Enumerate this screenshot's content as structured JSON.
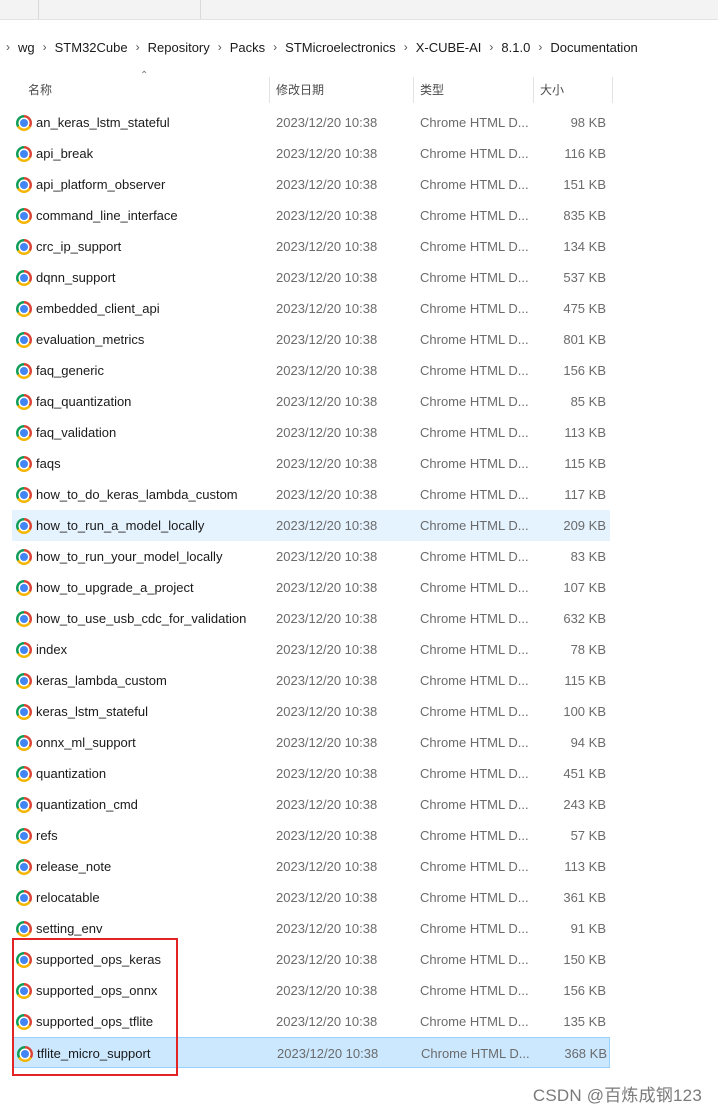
{
  "breadcrumb": [
    "wg",
    "STM32Cube",
    "Repository",
    "Packs",
    "STMicroelectronics",
    "X-CUBE-AI",
    "8.1.0",
    "Documentation"
  ],
  "columns": {
    "name": "名称",
    "date": "修改日期",
    "type": "类型",
    "size": "大小"
  },
  "files": [
    {
      "name": "an_keras_lstm_stateful",
      "date": "2023/12/20 10:38",
      "type": "Chrome HTML D...",
      "size": "98 KB"
    },
    {
      "name": "api_break",
      "date": "2023/12/20 10:38",
      "type": "Chrome HTML D...",
      "size": "116 KB"
    },
    {
      "name": "api_platform_observer",
      "date": "2023/12/20 10:38",
      "type": "Chrome HTML D...",
      "size": "151 KB"
    },
    {
      "name": "command_line_interface",
      "date": "2023/12/20 10:38",
      "type": "Chrome HTML D...",
      "size": "835 KB"
    },
    {
      "name": "crc_ip_support",
      "date": "2023/12/20 10:38",
      "type": "Chrome HTML D...",
      "size": "134 KB"
    },
    {
      "name": "dqnn_support",
      "date": "2023/12/20 10:38",
      "type": "Chrome HTML D...",
      "size": "537 KB"
    },
    {
      "name": "embedded_client_api",
      "date": "2023/12/20 10:38",
      "type": "Chrome HTML D...",
      "size": "475 KB"
    },
    {
      "name": "evaluation_metrics",
      "date": "2023/12/20 10:38",
      "type": "Chrome HTML D...",
      "size": "801 KB"
    },
    {
      "name": "faq_generic",
      "date": "2023/12/20 10:38",
      "type": "Chrome HTML D...",
      "size": "156 KB"
    },
    {
      "name": "faq_quantization",
      "date": "2023/12/20 10:38",
      "type": "Chrome HTML D...",
      "size": "85 KB"
    },
    {
      "name": "faq_validation",
      "date": "2023/12/20 10:38",
      "type": "Chrome HTML D...",
      "size": "113 KB"
    },
    {
      "name": "faqs",
      "date": "2023/12/20 10:38",
      "type": "Chrome HTML D...",
      "size": "115 KB"
    },
    {
      "name": "how_to_do_keras_lambda_custom",
      "date": "2023/12/20 10:38",
      "type": "Chrome HTML D...",
      "size": "117 KB"
    },
    {
      "name": "how_to_run_a_model_locally",
      "date": "2023/12/20 10:38",
      "type": "Chrome HTML D...",
      "size": "209 KB"
    },
    {
      "name": "how_to_run_your_model_locally",
      "date": "2023/12/20 10:38",
      "type": "Chrome HTML D...",
      "size": "83 KB"
    },
    {
      "name": "how_to_upgrade_a_project",
      "date": "2023/12/20 10:38",
      "type": "Chrome HTML D...",
      "size": "107 KB"
    },
    {
      "name": "how_to_use_usb_cdc_for_validation",
      "date": "2023/12/20 10:38",
      "type": "Chrome HTML D...",
      "size": "632 KB"
    },
    {
      "name": "index",
      "date": "2023/12/20 10:38",
      "type": "Chrome HTML D...",
      "size": "78 KB"
    },
    {
      "name": "keras_lambda_custom",
      "date": "2023/12/20 10:38",
      "type": "Chrome HTML D...",
      "size": "115 KB"
    },
    {
      "name": "keras_lstm_stateful",
      "date": "2023/12/20 10:38",
      "type": "Chrome HTML D...",
      "size": "100 KB"
    },
    {
      "name": "onnx_ml_support",
      "date": "2023/12/20 10:38",
      "type": "Chrome HTML D...",
      "size": "94 KB"
    },
    {
      "name": "quantization",
      "date": "2023/12/20 10:38",
      "type": "Chrome HTML D...",
      "size": "451 KB"
    },
    {
      "name": "quantization_cmd",
      "date": "2023/12/20 10:38",
      "type": "Chrome HTML D...",
      "size": "243 KB"
    },
    {
      "name": "refs",
      "date": "2023/12/20 10:38",
      "type": "Chrome HTML D...",
      "size": "57 KB"
    },
    {
      "name": "release_note",
      "date": "2023/12/20 10:38",
      "type": "Chrome HTML D...",
      "size": "113 KB"
    },
    {
      "name": "relocatable",
      "date": "2023/12/20 10:38",
      "type": "Chrome HTML D...",
      "size": "361 KB"
    },
    {
      "name": "setting_env",
      "date": "2023/12/20 10:38",
      "type": "Chrome HTML D...",
      "size": "91 KB"
    },
    {
      "name": "supported_ops_keras",
      "date": "2023/12/20 10:38",
      "type": "Chrome HTML D...",
      "size": "150 KB"
    },
    {
      "name": "supported_ops_onnx",
      "date": "2023/12/20 10:38",
      "type": "Chrome HTML D...",
      "size": "156 KB"
    },
    {
      "name": "supported_ops_tflite",
      "date": "2023/12/20 10:38",
      "type": "Chrome HTML D...",
      "size": "135 KB"
    },
    {
      "name": "tflite_micro_support",
      "date": "2023/12/20 10:38",
      "type": "Chrome HTML D...",
      "size": "368 KB"
    }
  ],
  "hover_row": "how_to_run_a_model_locally",
  "selected_row": "tflite_micro_support",
  "file_icon": "chrome-icon",
  "colors": {
    "hover": "#e5f3ff",
    "selected": "#cce8ff",
    "highlight_box": "#e32424"
  },
  "watermark": "CSDN @百炼成钢123"
}
